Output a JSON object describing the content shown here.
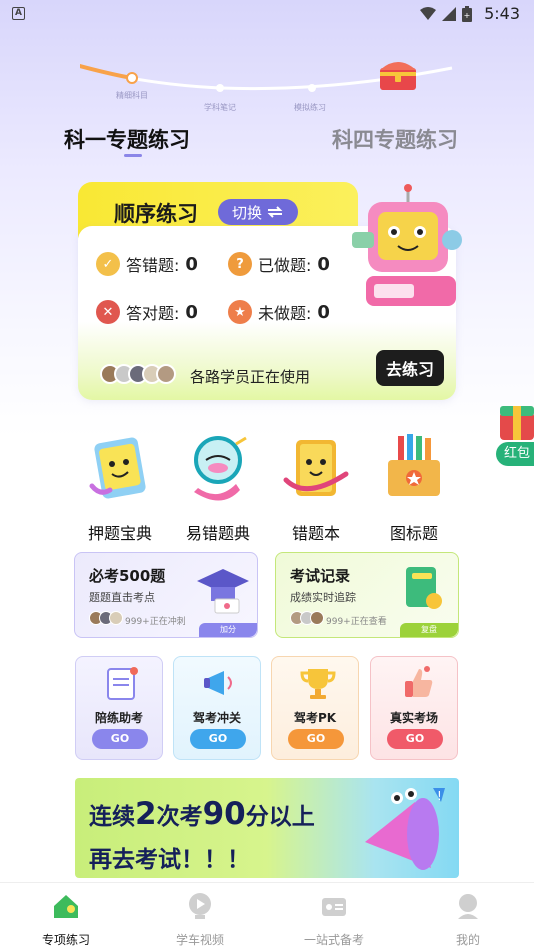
{
  "status_bar": {
    "time": "5:43",
    "app_indicator": "A"
  },
  "progress": {
    "labels": [
      "精细科目",
      "学科笔记",
      "模拟练习"
    ],
    "chest_icon": "treasure-chest-icon"
  },
  "top_tabs": {
    "k1": "科一专题练习",
    "k4": "科四专题练习"
  },
  "order_card": {
    "title": "顺序练习",
    "switch_label": "切换",
    "stats": {
      "wrong_label": "答错题:",
      "wrong_value": "0",
      "done_label": "已做题:",
      "done_value": "0",
      "right_label": "答对题:",
      "right_value": "0",
      "undone_label": "未做题:",
      "undone_value": "0"
    },
    "users_text": "各路学员正在使用",
    "go_label": "去练习"
  },
  "side_redpack": {
    "label": "红包"
  },
  "quick_items": [
    {
      "label": "押题宝典",
      "icon": "book-icon"
    },
    {
      "label": "易错题典",
      "icon": "magnifier-icon"
    },
    {
      "label": "错题本",
      "icon": "notebook-icon"
    },
    {
      "label": "图标题",
      "icon": "pencil-box-icon"
    }
  ],
  "mid_cards": {
    "must500": {
      "title": "必考500题",
      "sub": "题题直击考点",
      "count": "999+正在冲刺",
      "corner": "加分"
    },
    "record": {
      "title": "考试记录",
      "sub": "成绩实时追踪",
      "count": "999+正在查看",
      "corner": "复盘"
    }
  },
  "small_cards": [
    {
      "title": "陪练助考",
      "go": "GO",
      "color": "#8a86ec"
    },
    {
      "title": "驾考冲关",
      "go": "GO",
      "color": "#3fa6ec"
    },
    {
      "title": "驾考PK",
      "go": "GO",
      "color": "#f5973a"
    },
    {
      "title": "真实考场",
      "go": "GO",
      "color": "#f05a69"
    }
  ],
  "banner": {
    "prefix": "连续",
    "n1": "2",
    "mid": "次考",
    "n2": "90",
    "suffix": "分以上",
    "line2": "再去考试！！！"
  },
  "bottom_nav": [
    {
      "label": "专项练习",
      "active": true
    },
    {
      "label": "学车视频",
      "active": false
    },
    {
      "label": "一站式备考",
      "active": false
    },
    {
      "label": "我的",
      "active": false
    }
  ]
}
